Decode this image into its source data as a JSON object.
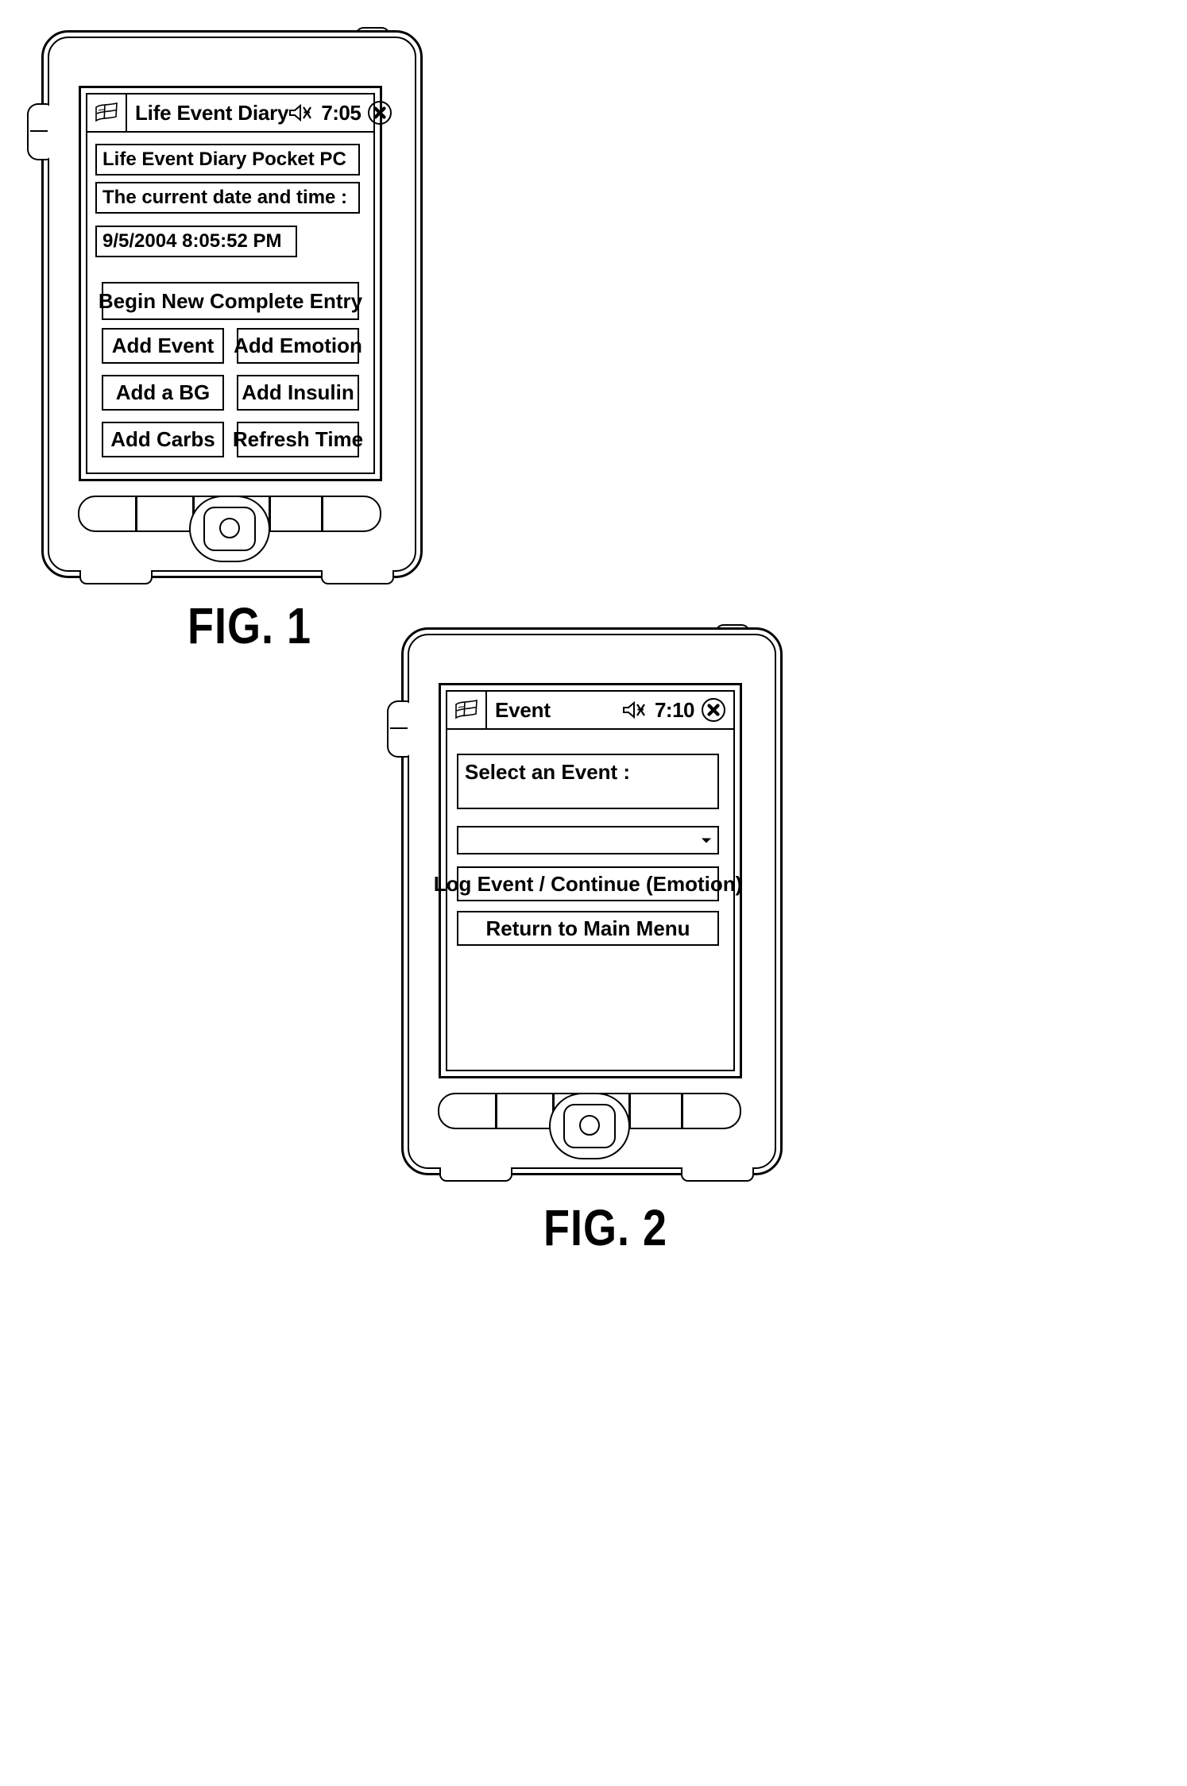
{
  "figures": [
    {
      "caption": "FIG. 1",
      "screen": {
        "titlebar": {
          "start_icon": "windows-flag-icon",
          "title": "Life Event Diary",
          "speaker_icon": "speaker-mute-icon",
          "clock": "7:05",
          "close_icon": "close-x-icon"
        },
        "fields": [
          {
            "name": "app-name-field",
            "value": "Life Event Diary Pocket PC"
          },
          {
            "name": "date-time-label-field",
            "value": "The current date and time :"
          },
          {
            "name": "date-time-value-field",
            "value": "9/5/2004  8:05:52  PM"
          }
        ],
        "primary_button": "Begin New Complete Entry",
        "grid_buttons": [
          "Add Event",
          "Add Emotion",
          "Add a BG",
          "Add Insulin",
          "Add Carbs",
          "Refresh Time"
        ]
      }
    },
    {
      "caption": "FIG. 2",
      "screen": {
        "titlebar": {
          "start_icon": "windows-flag-icon",
          "title": "Event",
          "speaker_icon": "speaker-mute-icon",
          "clock": "7:10",
          "close_icon": "close-x-icon"
        },
        "prompt_label": "Select an Event :",
        "combo": {
          "name": "event-select",
          "value": "",
          "arrow_icon": "chevron-down-icon"
        },
        "buttons": [
          "Log Event / Continue (Emotion)",
          "Return to Main Menu"
        ]
      }
    }
  ]
}
